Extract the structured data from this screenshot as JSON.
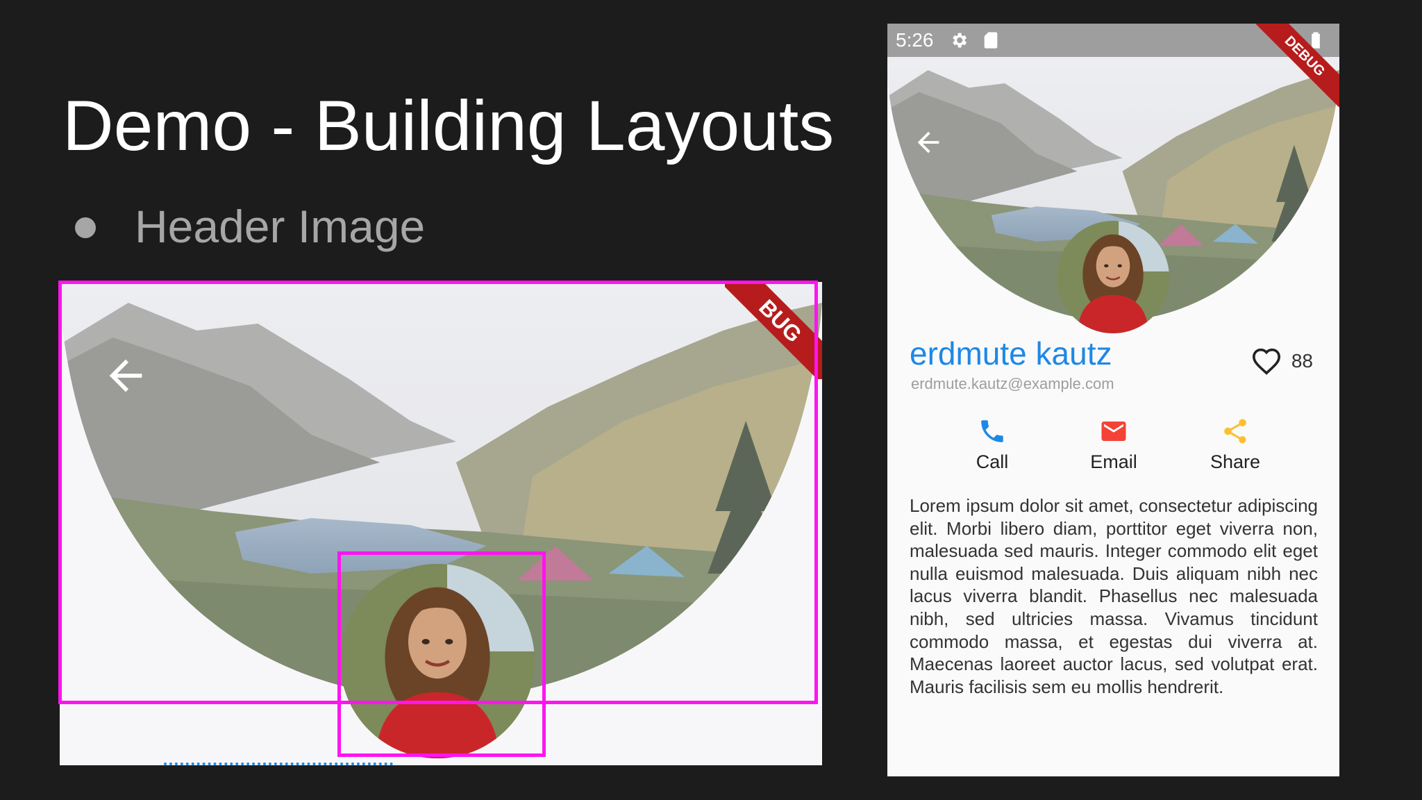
{
  "slide": {
    "title": "Demo - Building Layouts",
    "bullet": "Header Image"
  },
  "colors": {
    "background": "#1c1c1c",
    "highlight": "#ff14f0",
    "accent_blue": "#1e88e5",
    "email_red": "#f44336",
    "share_yellow": "#fbc02d",
    "debug_red": "#b71c1c"
  },
  "zoom_panel": {
    "debug_ribbon": "BUG",
    "back_icon": "arrow-back-icon"
  },
  "phone": {
    "status_bar": {
      "time": "5:26",
      "icons": [
        "gear-icon",
        "sd-card-icon",
        "wifi-icon",
        "battery-icon"
      ]
    },
    "debug_ribbon": "DEBUG",
    "back_icon": "arrow-back-icon",
    "profile": {
      "name": "erdmute kautz",
      "email": "erdmute.kautz@example.com",
      "likes": "88"
    },
    "actions": [
      {
        "label": "Call",
        "icon": "phone-icon"
      },
      {
        "label": "Email",
        "icon": "email-icon"
      },
      {
        "label": "Share",
        "icon": "share-icon"
      }
    ],
    "body_text": "Lorem ipsum dolor sit amet, consectetur adipiscing elit. Morbi libero diam, porttitor eget viverra non, malesuada sed mauris. Integer commodo elit eget nulla euismod malesuada. Duis aliquam nibh nec lacus viverra blandit. Phasellus nec malesuada nibh, sed ultricies massa. Vivamus tincidunt commodo massa, et egestas dui viverra at. Maecenas laoreet auctor lacus, sed volutpat erat. Mauris facilisis sem eu mollis hendrerit."
  }
}
